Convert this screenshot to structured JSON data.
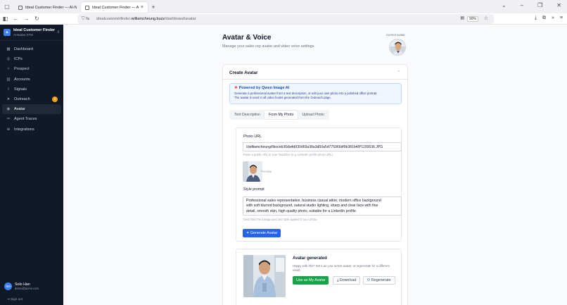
{
  "browser": {
    "tabs": [
      {
        "title": "Ideal Customer Finder — AI-Native",
        "active": false
      },
      {
        "title": "Ideal Customer Finder — AI-Native",
        "active": true
      }
    ],
    "url_prefix": "idealcustomerfinder.",
    "url_host": "williamcheung.buzz",
    "url_path": "/dashboard/avatar",
    "zoom": "90%"
  },
  "sidebar": {
    "brand_name": "Ideal Customer Finder",
    "brand_sub": "AI-Native GTM",
    "items": [
      {
        "label": "Dashboard",
        "icon": "grid-icon"
      },
      {
        "label": "ICPs",
        "icon": "target-icon"
      },
      {
        "label": "Prospect",
        "icon": "sparkle-icon"
      },
      {
        "label": "Accounts",
        "icon": "building-icon"
      },
      {
        "label": "Signals",
        "icon": "signal-icon"
      },
      {
        "label": "Outreach",
        "icon": "send-icon",
        "badge": "6"
      },
      {
        "label": "Avatar",
        "icon": "user-circle-icon",
        "active": true
      },
      {
        "label": "Agent Traces",
        "icon": "trace-icon"
      },
      {
        "label": "Integrations",
        "icon": "plug-icon"
      }
    ],
    "user": {
      "initials": "SH",
      "name": "Solo Han",
      "email": "demo@acme.com"
    },
    "sign_out": "Sign out"
  },
  "page": {
    "title": "Avatar & Voice",
    "subtitle": "Manage your sales rep avatar and video voice settings",
    "current_avatar_label": "Current avatar"
  },
  "card": {
    "title": "Create Avatar",
    "info_title": "Powered by Qwen Image AI",
    "info_line1": "Generate a professional avatar from a text description, or edit your own photo into a polished office portrait.",
    "info_line2": "The avatar is used in all video hooks generated from the Outreach page.",
    "tabs": [
      "Text Description",
      "From My Photo",
      "Upload Photo"
    ],
    "active_tab": 1,
    "photo_url_label": "Photo URL",
    "photo_url_value": "\\/williamcheung/files/eb36da4d930d69a38a3d50a5d775966df9b381b4/P1100636.JPG",
    "photo_url_hint": "Paste a public URL to your headshot (e.g. LinkedIn profile photo URL)",
    "preview_label": "Preview",
    "style_label": "Style prompt",
    "style_line1": "Professional sales representative, business casual attire, modern office background",
    "style_line2": "with soft blurred background, natural studio lighting, sharp and clear face with fine",
    "style_line3": "detail, smooth skin, high quality photo, suitable for a LinkedIn profile.",
    "style_hint": "Describes the background and style applied to your photo.",
    "generate_label": "Generate Avatar"
  },
  "result": {
    "title": "Avatar generated",
    "desc": "Happy with this? Set it as your active avatar, or regenerate for a different result.",
    "use_label": "Use as My Avatar",
    "download_label": "Download",
    "regenerate_label": "Regenerate"
  }
}
